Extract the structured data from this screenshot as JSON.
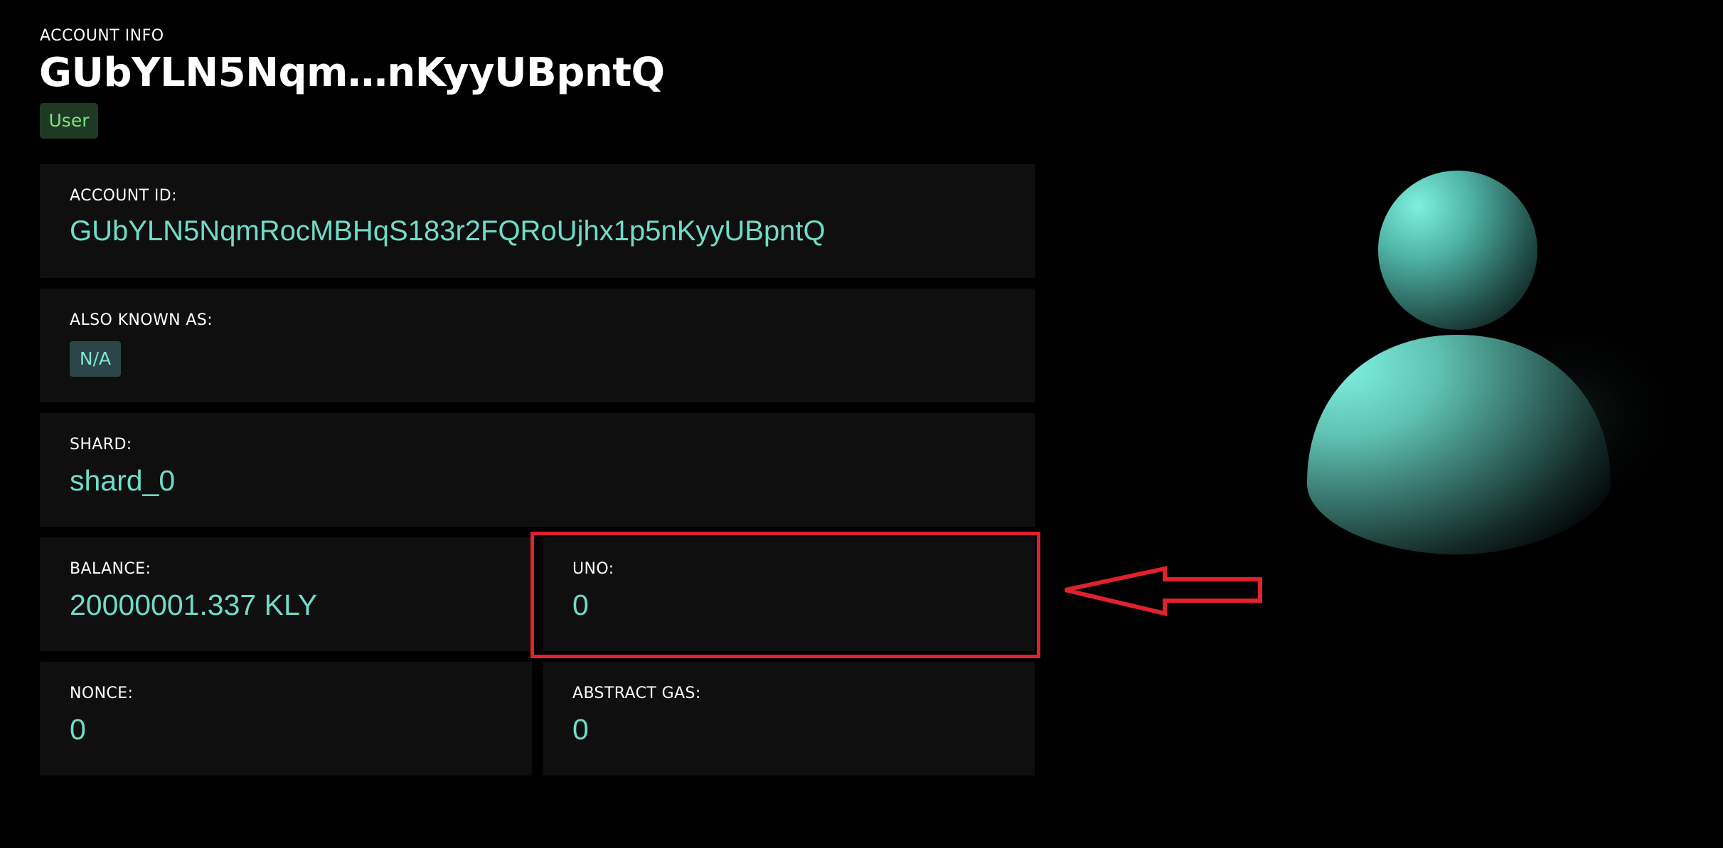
{
  "header": {
    "section_label": "ACCOUNT INFO",
    "title": "GUbYLN5Nqm…nKyyUBpntQ",
    "role_badge": "User"
  },
  "cards": {
    "account_id": {
      "label": "ACCOUNT ID:",
      "value": "GUbYLN5NqmRocMBHqS183r2FQRoUjhx1p5nKyyUBpntQ"
    },
    "aka": {
      "label": "ALSO KNOWN AS:",
      "value": "N/A"
    },
    "shard": {
      "label": "SHARD:",
      "value": "shard_0"
    },
    "balance": {
      "label": "BALANCE:",
      "value": "20000001.337 KLY"
    },
    "uno": {
      "label": "UNO:",
      "value": "0"
    },
    "nonce": {
      "label": "NONCE:",
      "value": "0"
    },
    "abstract_gas": {
      "label": "ABSTRACT GAS:",
      "value": "0"
    }
  },
  "colors": {
    "background": "#000000",
    "card_background": "#0f0f0f",
    "value_accent": "#6fdcc8",
    "badge_text": "#7ee081",
    "badge_background": "#1f3a24",
    "annotation_red": "#e0222c"
  },
  "icons": {
    "avatar": "user-avatar-icon",
    "annotation_arrow": "left-arrow-icon"
  }
}
